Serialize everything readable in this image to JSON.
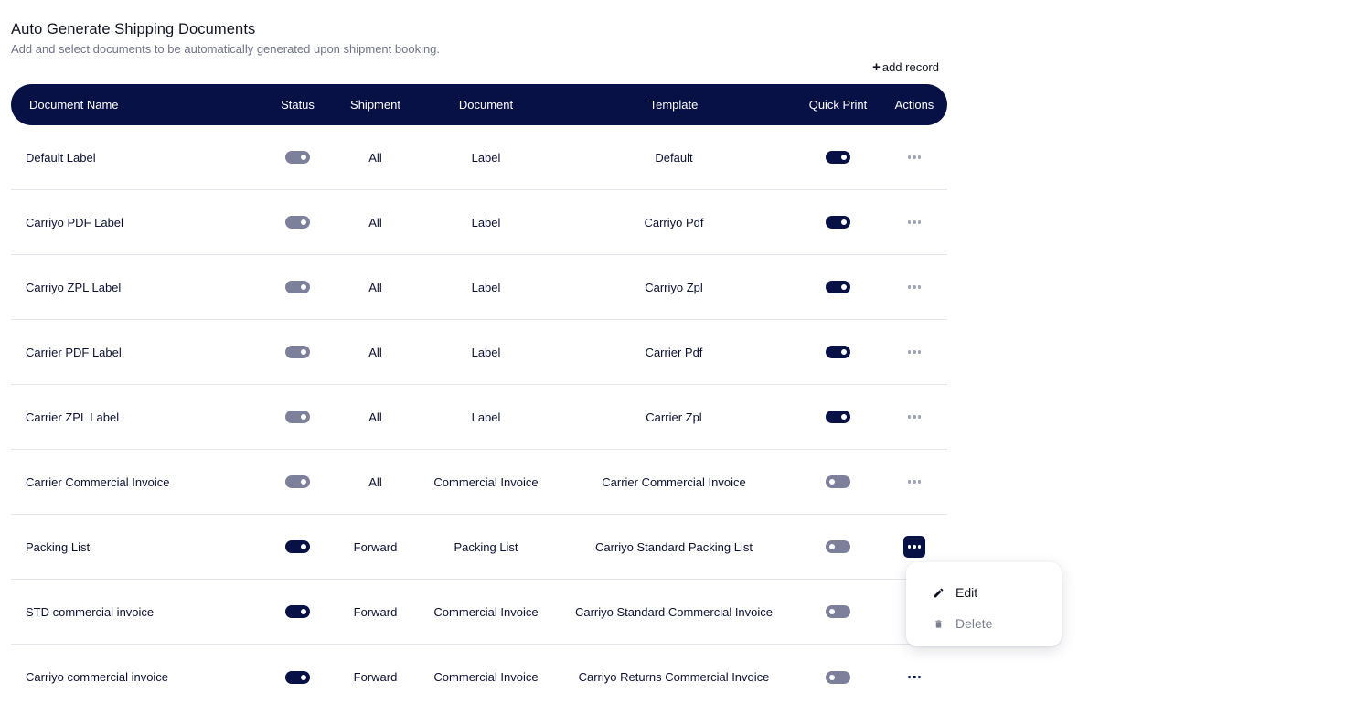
{
  "header": {
    "title": "Auto Generate Shipping Documents",
    "subtitle": "Add and select documents to be automatically generated upon shipment booking.",
    "add_plus": "+",
    "add_label": "add record"
  },
  "table": {
    "columns": {
      "name": "Document Name",
      "status": "Status",
      "shipment": "Shipment",
      "document": "Document",
      "template": "Template",
      "quick_print": "Quick Print",
      "actions": "Actions"
    },
    "rows": [
      {
        "name": "Default Label",
        "status": false,
        "shipment": "All",
        "document": "Label",
        "template": "Default",
        "quick_print": true
      },
      {
        "name": "Carriyo PDF Label",
        "status": false,
        "shipment": "All",
        "document": "Label",
        "template": "Carriyo Pdf",
        "quick_print": true
      },
      {
        "name": "Carriyo ZPL Label",
        "status": false,
        "shipment": "All",
        "document": "Label",
        "template": "Carriyo Zpl",
        "quick_print": true
      },
      {
        "name": "Carrier PDF Label",
        "status": false,
        "shipment": "All",
        "document": "Label",
        "template": "Carrier Pdf",
        "quick_print": true
      },
      {
        "name": "Carrier ZPL Label",
        "status": false,
        "shipment": "All",
        "document": "Label",
        "template": "Carrier Zpl",
        "quick_print": true
      },
      {
        "name": "Carrier Commercial Invoice",
        "status": false,
        "shipment": "All",
        "document": "Commercial Invoice",
        "template": "Carrier Commercial Invoice",
        "quick_print": false
      },
      {
        "name": "Packing List",
        "status": true,
        "shipment": "Forward",
        "document": "Packing List",
        "template": "Carriyo Standard Packing List",
        "quick_print": false
      },
      {
        "name": "STD commercial invoice",
        "status": true,
        "shipment": "Forward",
        "document": "Commercial Invoice",
        "template": "Carriyo Standard Commercial Invoice",
        "quick_print": false
      },
      {
        "name": "Carriyo commercial invoice",
        "status": true,
        "shipment": "Forward",
        "document": "Commercial Invoice",
        "template": "Carriyo Returns Commercial Invoice",
        "quick_print": false
      }
    ]
  },
  "actions_menu": {
    "edit_label": "Edit",
    "delete_label": "Delete"
  },
  "colors": {
    "accent": "#071145",
    "toggle_off": "#7c809a",
    "muted_text": "#6e7286"
  }
}
